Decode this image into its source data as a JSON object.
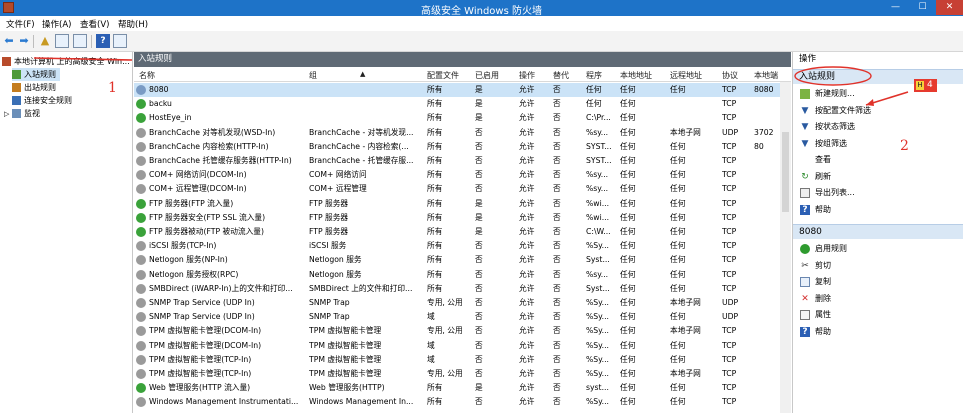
{
  "window": {
    "title": "高级安全 Windows 防火墙",
    "min_label": "—",
    "max_label": "☐",
    "close_label": "✕"
  },
  "menu": [
    "文件(F)",
    "操作(A)",
    "查看(V)",
    "帮助(H)"
  ],
  "tree": {
    "root": "本地计算机 上的高级安全 Win...",
    "items": [
      "入站规则",
      "出站规则",
      "连接安全规则",
      "监视"
    ]
  },
  "main": {
    "header": "入站规则",
    "columns": [
      "名称",
      "组",
      "配置文件",
      "已启用",
      "操作",
      "替代",
      "程序",
      "本地地址",
      "远程地址",
      "协议",
      "本地端"
    ],
    "rows": [
      {
        "status": "off",
        "name": "8080",
        "group": "",
        "profile": "所有",
        "enabled": "是",
        "action": "允许",
        "override": "否",
        "program": "任何",
        "local": "任何",
        "remote": "任何",
        "proto": "TCP",
        "port": "8080"
      },
      {
        "status": "on",
        "name": "backu",
        "group": "",
        "profile": "所有",
        "enabled": "是",
        "action": "允许",
        "override": "否",
        "program": "任何",
        "local": "任何",
        "remote": "",
        "proto": "TCP",
        "port": ""
      },
      {
        "status": "on",
        "name": "HostEye_in",
        "group": "",
        "profile": "所有",
        "enabled": "是",
        "action": "允许",
        "override": "否",
        "program": "C:\\Pr...",
        "local": "任何",
        "remote": "",
        "proto": "TCP",
        "port": ""
      },
      {
        "status": "off",
        "name": "BranchCache 对等机发现(WSD-In)",
        "group": "BranchCache - 对等机发现...",
        "profile": "所有",
        "enabled": "否",
        "action": "允许",
        "override": "否",
        "program": "%sy...",
        "local": "任何",
        "remote": "本地子网",
        "proto": "UDP",
        "port": "3702"
      },
      {
        "status": "off",
        "name": "BranchCache 内容检索(HTTP-In)",
        "group": "BranchCache - 内容检索(...",
        "profile": "所有",
        "enabled": "否",
        "action": "允许",
        "override": "否",
        "program": "SYST...",
        "local": "任何",
        "remote": "任何",
        "proto": "TCP",
        "port": "80"
      },
      {
        "status": "off",
        "name": "BranchCache 托管缓存服务器(HTTP-In)",
        "group": "BranchCache - 托管缓存服...",
        "profile": "所有",
        "enabled": "否",
        "action": "允许",
        "override": "否",
        "program": "SYST...",
        "local": "任何",
        "remote": "任何",
        "proto": "TCP",
        "port": ""
      },
      {
        "status": "off",
        "name": "COM+ 网络访问(DCOM-In)",
        "group": "COM+ 网络访问",
        "profile": "所有",
        "enabled": "否",
        "action": "允许",
        "override": "否",
        "program": "%sy...",
        "local": "任何",
        "remote": "任何",
        "proto": "TCP",
        "port": ""
      },
      {
        "status": "off",
        "name": "COM+ 远程管理(DCOM-In)",
        "group": "COM+ 远程管理",
        "profile": "所有",
        "enabled": "否",
        "action": "允许",
        "override": "否",
        "program": "%sy...",
        "local": "任何",
        "remote": "任何",
        "proto": "TCP",
        "port": ""
      },
      {
        "status": "on",
        "name": "FTP 服务器(FTP 流入量)",
        "group": "FTP 服务器",
        "profile": "所有",
        "enabled": "是",
        "action": "允许",
        "override": "否",
        "program": "%wi...",
        "local": "任何",
        "remote": "任何",
        "proto": "TCP",
        "port": ""
      },
      {
        "status": "on",
        "name": "FTP 服务器安全(FTP SSL 流入量)",
        "group": "FTP 服务器",
        "profile": "所有",
        "enabled": "是",
        "action": "允许",
        "override": "否",
        "program": "%wi...",
        "local": "任何",
        "remote": "任何",
        "proto": "TCP",
        "port": ""
      },
      {
        "status": "on",
        "name": "FTP 服务器被动(FTP 被动流入量)",
        "group": "FTP 服务器",
        "profile": "所有",
        "enabled": "是",
        "action": "允许",
        "override": "否",
        "program": "C:\\W...",
        "local": "任何",
        "remote": "任何",
        "proto": "TCP",
        "port": ""
      },
      {
        "status": "off",
        "name": "iSCSI 服务(TCP-In)",
        "group": "iSCSI 服务",
        "profile": "所有",
        "enabled": "否",
        "action": "允许",
        "override": "否",
        "program": "%Sy...",
        "local": "任何",
        "remote": "任何",
        "proto": "TCP",
        "port": ""
      },
      {
        "status": "off",
        "name": "Netlogon 服务(NP-In)",
        "group": "Netlogon 服务",
        "profile": "所有",
        "enabled": "否",
        "action": "允许",
        "override": "否",
        "program": "Syst...",
        "local": "任何",
        "remote": "任何",
        "proto": "TCP",
        "port": ""
      },
      {
        "status": "off",
        "name": "Netlogon 服务授权(RPC)",
        "group": "Netlogon 服务",
        "profile": "所有",
        "enabled": "否",
        "action": "允许",
        "override": "否",
        "program": "%sy...",
        "local": "任何",
        "remote": "任何",
        "proto": "TCP",
        "port": ""
      },
      {
        "status": "off",
        "name": "SMBDirect (iWARP-In)上的文件和打印...",
        "group": "SMBDirect 上的文件和打印...",
        "profile": "所有",
        "enabled": "否",
        "action": "允许",
        "override": "否",
        "program": "Syst...",
        "local": "任何",
        "remote": "任何",
        "proto": "TCP",
        "port": ""
      },
      {
        "status": "off",
        "name": "SNMP Trap Service (UDP In)",
        "group": "SNMP Trap",
        "profile": "专用, 公用",
        "enabled": "否",
        "action": "允许",
        "override": "否",
        "program": "%Sy...",
        "local": "任何",
        "remote": "本地子网",
        "proto": "UDP",
        "port": ""
      },
      {
        "status": "off",
        "name": "SNMP Trap Service (UDP In)",
        "group": "SNMP Trap",
        "profile": "域",
        "enabled": "否",
        "action": "允许",
        "override": "否",
        "program": "%Sy...",
        "local": "任何",
        "remote": "任何",
        "proto": "UDP",
        "port": ""
      },
      {
        "status": "off",
        "name": "TPM 虚拟智能卡管理(DCOM-In)",
        "group": "TPM 虚拟智能卡管理",
        "profile": "专用, 公用",
        "enabled": "否",
        "action": "允许",
        "override": "否",
        "program": "%Sy...",
        "local": "任何",
        "remote": "本地子网",
        "proto": "TCP",
        "port": ""
      },
      {
        "status": "off",
        "name": "TPM 虚拟智能卡管理(DCOM-In)",
        "group": "TPM 虚拟智能卡管理",
        "profile": "域",
        "enabled": "否",
        "action": "允许",
        "override": "否",
        "program": "%Sy...",
        "local": "任何",
        "remote": "任何",
        "proto": "TCP",
        "port": ""
      },
      {
        "status": "off",
        "name": "TPM 虚拟智能卡管理(TCP-In)",
        "group": "TPM 虚拟智能卡管理",
        "profile": "域",
        "enabled": "否",
        "action": "允许",
        "override": "否",
        "program": "%Sy...",
        "local": "任何",
        "remote": "任何",
        "proto": "TCP",
        "port": ""
      },
      {
        "status": "off",
        "name": "TPM 虚拟智能卡管理(TCP-In)",
        "group": "TPM 虚拟智能卡管理",
        "profile": "专用, 公用",
        "enabled": "否",
        "action": "允许",
        "override": "否",
        "program": "%Sy...",
        "local": "任何",
        "remote": "本地子网",
        "proto": "TCP",
        "port": ""
      },
      {
        "status": "on",
        "name": "Web 管理服务(HTTP 流入量)",
        "group": "Web 管理服务(HTTP)",
        "profile": "所有",
        "enabled": "是",
        "action": "允许",
        "override": "否",
        "program": "syst...",
        "local": "任何",
        "remote": "任何",
        "proto": "TCP",
        "port": ""
      },
      {
        "status": "off",
        "name": "Windows Management Instrumentati...",
        "group": "Windows Management In...",
        "profile": "所有",
        "enabled": "否",
        "action": "允许",
        "override": "否",
        "program": "%Sy...",
        "local": "任何",
        "remote": "任何",
        "proto": "TCP",
        "port": ""
      }
    ]
  },
  "actions": {
    "title": "操作",
    "section1": "入站规则",
    "items1": [
      {
        "icon": "new-rule-icon",
        "label": "新建规则..."
      },
      {
        "icon": "filter-icon",
        "label": "按配置文件筛选"
      },
      {
        "icon": "filter-icon",
        "label": "按状态筛选"
      },
      {
        "icon": "filter-icon",
        "label": "按组筛选"
      },
      {
        "icon": "",
        "label": "查看"
      },
      {
        "icon": "refresh-icon",
        "label": "刷新"
      },
      {
        "icon": "export-icon",
        "label": "导出列表..."
      },
      {
        "icon": "help-icon",
        "label": "帮助"
      }
    ],
    "section2": "8080",
    "items2": [
      {
        "icon": "enable-icon",
        "label": "启用规则"
      },
      {
        "icon": "cut-icon",
        "label": "剪切"
      },
      {
        "icon": "copy-icon",
        "label": "复制"
      },
      {
        "icon": "delete-icon",
        "label": "删除"
      },
      {
        "icon": "properties-icon",
        "label": "属性"
      },
      {
        "icon": "help-icon",
        "label": "帮助"
      }
    ]
  },
  "annotations": {
    "one": "1",
    "two": "2",
    "badge": "4"
  },
  "colors": {
    "titlebar": "#1e73c8",
    "annotation": "#e0322a",
    "enabled": "#3aa23a",
    "disabled": "#9a9a9a"
  }
}
